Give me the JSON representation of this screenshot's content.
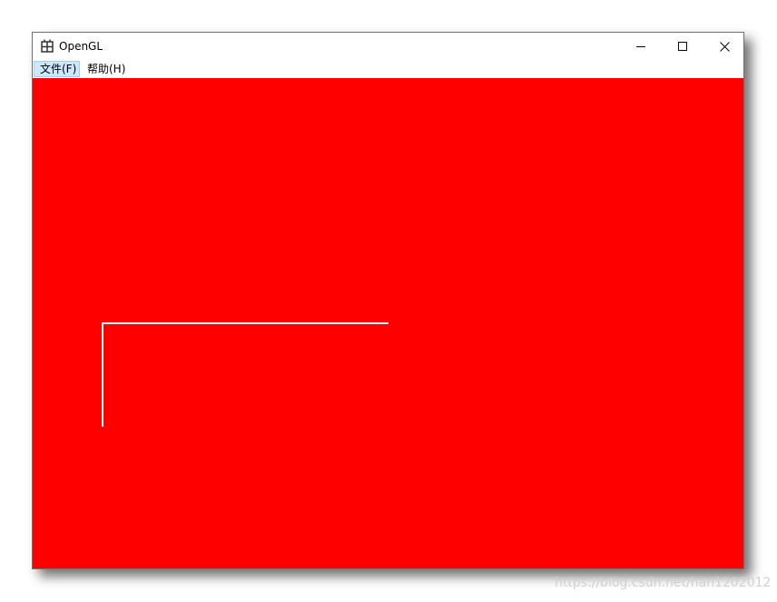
{
  "window": {
    "title": "OpenGL",
    "icon": "app-window-icon",
    "controls": {
      "minimize_icon": "minimize-icon",
      "maximize_icon": "maximize-icon",
      "close_icon": "close-icon"
    }
  },
  "menubar": {
    "items": [
      {
        "label": "文件(F)",
        "active": true
      },
      {
        "label": "帮助(H)",
        "active": false
      }
    ]
  },
  "canvas": {
    "background_color": "#ff0000",
    "line_color": "#ffffff"
  },
  "watermark": {
    "text": "https://blog.csdn.net/han1202012"
  }
}
